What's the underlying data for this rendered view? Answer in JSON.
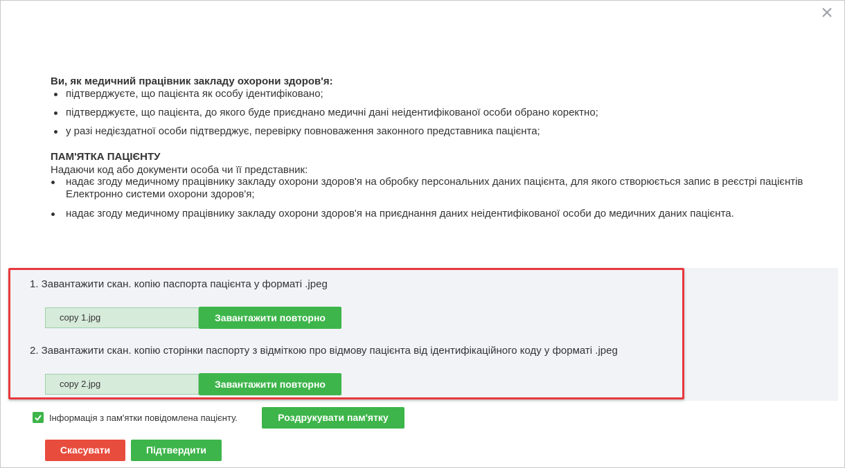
{
  "dialog": {
    "close_icon": "close-icon"
  },
  "intro": {
    "heading": "Ви, як медичний працівник закладу охорони здоров'я:",
    "items": [
      "підтверджуєте, що пацієнта як особу ідентифіковано;",
      "підтверджуєте, що пацієнта, до якого буде приєднано медичні дані неідентифікованої особи обрано коректно;",
      "у разі недієздатної особи підтверджує, перевірку повноваження законного представника пацієнта;"
    ]
  },
  "memo": {
    "title": "ПАМ'ЯТКА ПАЦІЄНТУ",
    "subtitle": "Надаючи код або документи особа чи її представник:",
    "items": [
      "надає згоду медичному працівнику закладу охорони здоров'я на обробку персональних даних пацієнта, для якого створюється запис в реєстрі пацієнтів Електронно системи охорони здоров'я;",
      "надає згоду медичному працівнику закладу охорони здоров'я на приєднання даних неідентифікованої особи до медичних даних пацієнта."
    ]
  },
  "uploads": [
    {
      "label": "1. Завантажити скан. копію паспорта пацієнта у форматі .jpeg",
      "file_name": "copy 1.jpg",
      "button_label": "Завантажити повторно"
    },
    {
      "label": "2. Завантажити скан. копію сторінки паспорту з відміткою про відмову пацієнта від ідентифікаційного коду у форматі .jpeg",
      "file_name": "copy 2.jpg",
      "button_label": "Завантажити повторно"
    }
  ],
  "confirmation": {
    "checked": true,
    "label": "Інформація з пам'ятки повідомлена пацієнту.",
    "print_button": "Роздрукувати пам'ятку"
  },
  "actions": {
    "cancel_label": "Скасувати",
    "confirm_label": "Підтвердити"
  },
  "colors": {
    "primary_green": "#3db54a",
    "danger_red": "#e84c3d",
    "highlight_red": "#e8383d"
  }
}
